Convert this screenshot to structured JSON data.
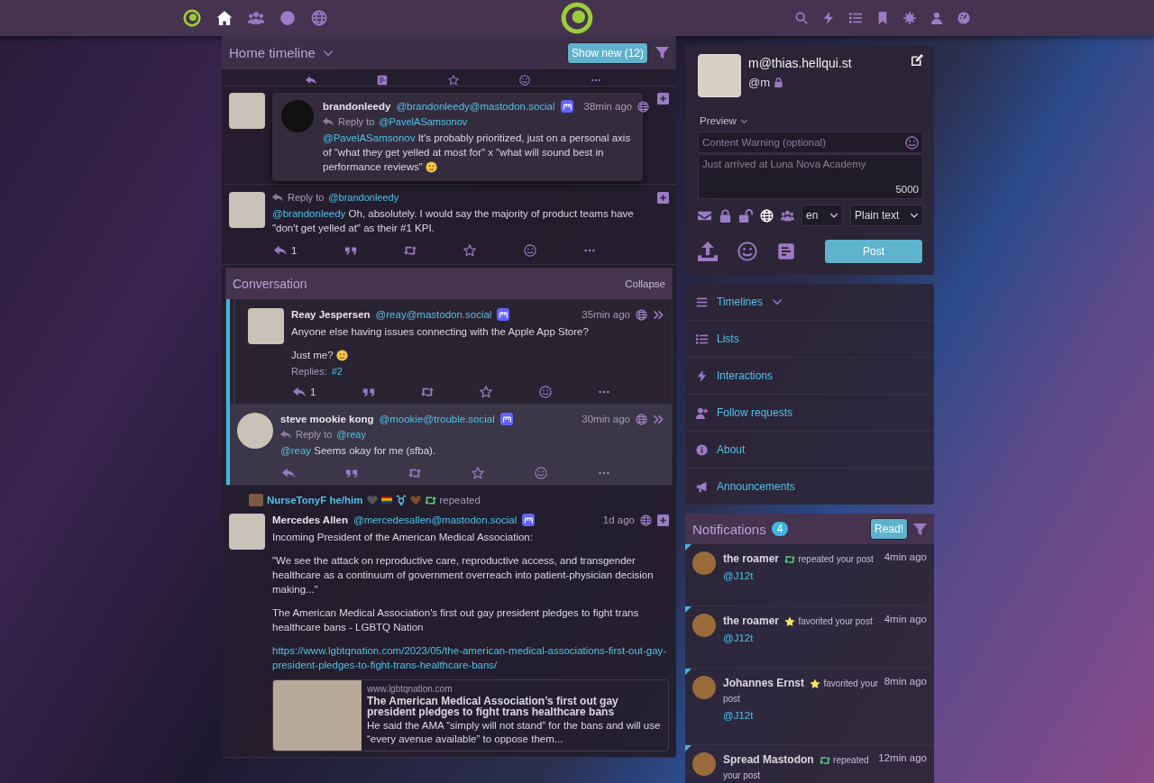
{
  "top_bar": {
    "nav_icons": [
      {
        "kind": "home",
        "selected": true
      },
      {
        "kind": "people",
        "selected": false
      },
      {
        "kind": "circle",
        "selected": false
      },
      {
        "kind": "globe",
        "selected": false
      }
    ],
    "tool_icons": [
      {
        "kind": "search"
      },
      {
        "kind": "bolt"
      },
      {
        "kind": "list"
      },
      {
        "kind": "bookmark"
      },
      {
        "kind": "gear"
      },
      {
        "kind": "user"
      },
      {
        "kind": "dashboard"
      }
    ]
  },
  "timeline": {
    "title": "Home timeline",
    "show_new": "Show new (12)",
    "items": [
      {
        "kind": "preview",
        "popover": {
          "name": "brandonleedy",
          "handle": "@brandonleedy@mastodon.social",
          "time": "38min ago",
          "reply_to": {
            "label": "Reply to",
            "mention": "@PavelASamsonov"
          },
          "body": [
            {
              "mention": "@PavelASamsonov",
              "text": " It's probably prioritized, just on a personal axis of \"what they get yelled at most for\" x \"what will sound best in performance reviews\"",
              "emoji": true
            }
          ]
        }
      },
      {
        "kind": "status",
        "status": {
          "reply_to": {
            "label": "Reply to",
            "mention": "@brandonleedy"
          },
          "body": [
            {
              "mention": "@brandonleedy",
              "text": " Oh, absolutely. I would say the majority of product teams have \"don't get yelled at\" as their #1 KPI."
            }
          ],
          "reply_count": "1"
        }
      },
      {
        "kind": "conversation",
        "title": "Conversation",
        "collapse": "Collapse",
        "statuses": [
          {
            "name": "Reay Jespersen",
            "handle": "@reay@mastodon.social",
            "time": "35min ago",
            "selected": false,
            "body": [
              {
                "text": "Anyone else having issues connecting with the Apple App Store?"
              },
              {
                "text": "Just me?",
                "emoji": true
              }
            ],
            "replies": {
              "label": "Replies:",
              "link": "#2"
            },
            "reply_count": "1"
          },
          {
            "name": "steve mookie kong",
            "handle": "@mookie@trouble.social",
            "time": "30min ago",
            "selected": true,
            "reply_to": {
              "label": "Reply to",
              "mention": "@reay"
            },
            "body": [
              {
                "mention": "@reay",
                "text": " Seems okay for me (sfba)."
              }
            ]
          }
        ]
      },
      {
        "kind": "status",
        "status": {
          "reblogged_by": {
            "name": "NurseTonyF he/him",
            "label": "repeated"
          },
          "name": "Mercedes Allen",
          "handle": "@mercedesallen@mastodon.social",
          "time": "1d ago",
          "body": [
            {
              "text": "Incoming President of the American Medical Association:"
            },
            {
              "text": "\"We see the attack on reproductive care, reproductive access, and transgender healthcare as a continuum of government overreach into patient-physician decision making...\""
            },
            {
              "text": "The American Medical Association's first out gay president pledges to fight trans healthcare bans - LGBTQ Nation",
              "url": "https://www.lgbtqnation.com/2023/05/the-american-medical-associations-first-out-gay-president-pledges-to-fight-trans-healthcare-bans/"
            }
          ],
          "card": {
            "site": "www.lgbtqnation.com",
            "title": "The American Medical Association’s first out gay president pledges to fight trans healthcare bans",
            "description": "He said the AMA “simply will not stand” for the bans and will use “every avenue available” to oppose them..."
          }
        }
      }
    ]
  },
  "compose": {
    "name": "m@thias.hellqui.st",
    "handle": "@m",
    "locked": true,
    "preview": "Preview",
    "cw_placeholder": "Content Warning (optional)",
    "text_placeholder": "Just arrived at Luna Nova Academy",
    "counter": "5000",
    "visibility": [
      {
        "kind": "direct",
        "selected": false
      },
      {
        "kind": "private",
        "selected": false
      },
      {
        "kind": "unlisted",
        "selected": false
      },
      {
        "kind": "public",
        "selected": true
      },
      {
        "kind": "followers",
        "selected": false
      }
    ],
    "language": "en",
    "format": "Plain text",
    "post": "Post"
  },
  "menu": {
    "items": [
      {
        "label": "Timelines",
        "expandable": true
      },
      {
        "label": "Lists",
        "expandable": false
      },
      {
        "label": "Interactions",
        "expandable": false
      },
      {
        "label": "Follow requests",
        "expandable": false
      },
      {
        "label": "About",
        "expandable": false
      },
      {
        "label": "Announcements",
        "expandable": false
      }
    ]
  },
  "notifications": {
    "title": "Notifications",
    "count": "4",
    "read_button": "Read!",
    "items": [
      {
        "name": "the roamer",
        "kind": "repeat",
        "action": "repeated your post",
        "time": "4min ago",
        "mention": "@J12t",
        "unread": true
      },
      {
        "name": "the roamer",
        "kind": "favorite",
        "action": "favorited your post",
        "time": "4min ago",
        "mention": "@J12t",
        "unread": true
      },
      {
        "name": "Johannes Ernst",
        "kind": "favorite",
        "action": "favorited your post",
        "time": "8min ago",
        "mention": "@J12t",
        "unread": true
      },
      {
        "name": "Spread Mastodon",
        "kind": "repeat",
        "action": "repeated your post",
        "time": "12min ago",
        "unread": true
      }
    ]
  }
}
